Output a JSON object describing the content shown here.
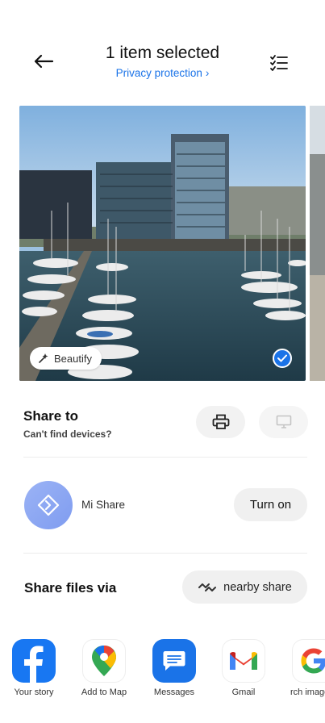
{
  "header": {
    "title": "1 item selected",
    "privacy_link": "Privacy protection",
    "privacy_chevron": "›"
  },
  "photo": {
    "beautify_label": "Beautify"
  },
  "share_to": {
    "title": "Share to",
    "subtitle": "Can't find devices?"
  },
  "mi_share": {
    "label": "Mi Share",
    "turn_on_label": "Turn on"
  },
  "share_files": {
    "title": "Share files via",
    "nearby_label": "nearby share"
  },
  "apps": [
    {
      "label": "Your story",
      "icon": "facebook-icon",
      "color": "#1877f2"
    },
    {
      "label": "Add to Map",
      "icon": "google-maps-icon",
      "color": "#ffffff"
    },
    {
      "label": "Messages",
      "icon": "messages-icon",
      "color": "#1a73e8"
    },
    {
      "label": "Gmail",
      "icon": "gmail-icon",
      "color": "#ffffff"
    },
    {
      "label": "rch image",
      "icon": "google-icon",
      "color": "#ffffff"
    }
  ],
  "colors": {
    "accent": "#1a73e8",
    "mi_share_gradient": "#8fa9f3"
  }
}
